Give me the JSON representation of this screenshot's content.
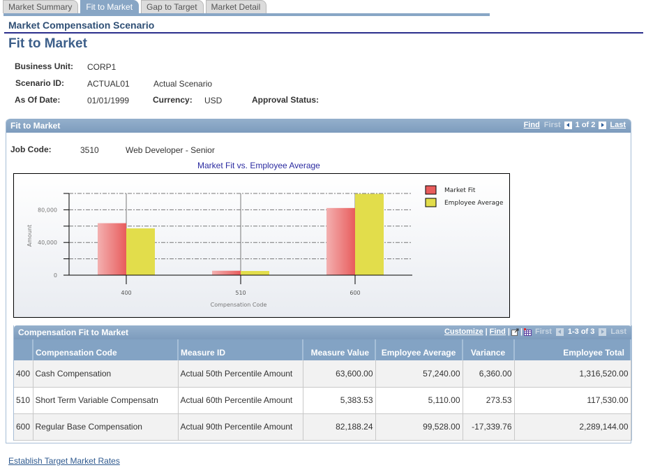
{
  "tabs": [
    {
      "label": "Market Summary",
      "active": false
    },
    {
      "label": "Fit to Market",
      "active": true
    },
    {
      "label": "Gap to Target",
      "active": false
    },
    {
      "label": "Market Detail",
      "active": false
    }
  ],
  "header": {
    "subtitle": "Market Compensation Scenario",
    "title": "Fit to Market"
  },
  "info": {
    "business_unit_label": "Business Unit:",
    "business_unit": "CORP1",
    "scenario_id_label": "Scenario ID:",
    "scenario_id": "ACTUAL01",
    "scenario_desc": "Actual Scenario",
    "as_of_date_label": "As Of Date:",
    "as_of_date": "01/01/1999",
    "currency_label": "Currency:",
    "currency": "USD",
    "approval_status_label": "Approval Status:"
  },
  "group": {
    "title": "Fit to Market",
    "nav": {
      "find": "Find",
      "first": "First",
      "position": "1 of 2",
      "last": "Last"
    },
    "job_code_label": "Job Code:",
    "job_code": "3510",
    "job_desc": "Web Developer - Senior"
  },
  "chart_data": {
    "type": "bar",
    "title": "Market Fit vs. Employee Average",
    "xlabel": "Compensation Code",
    "ylabel": "Amount",
    "categories": [
      "400",
      "510",
      "600"
    ],
    "series": [
      {
        "name": "Market Fit",
        "values": [
          63600.0,
          5383.53,
          82188.24
        ],
        "color": "#e85c5c"
      },
      {
        "name": "Employee Average",
        "values": [
          57240.0,
          5110.0,
          99528.0
        ],
        "color": "#e2dd4b"
      }
    ],
    "ylim": [
      0,
      100000
    ],
    "yticks": [
      0,
      20000,
      40000,
      60000,
      80000,
      100000
    ],
    "ytick_labels": [
      "0",
      "",
      "40,000",
      "",
      "80,000",
      ""
    ],
    "grid": true,
    "legend": "top-right"
  },
  "grid": {
    "title": "Compensation Fit to Market",
    "nav": {
      "customize": "Customize",
      "find": "Find",
      "first": "First",
      "position": "1-3 of 3",
      "last": "Last"
    },
    "columns": [
      "",
      "Compensation Code",
      "Measure ID",
      "Measure Value",
      "Employee Average",
      "Variance",
      "Employee Total"
    ],
    "rows": [
      {
        "code": "400",
        "desc": "Cash Compensation",
        "measure": "Actual 50th Percentile Amount",
        "value": "63,600.00",
        "avg": "57,240.00",
        "variance": "6,360.00",
        "total": "1,316,520.00"
      },
      {
        "code": "510",
        "desc": "Short Term Variable Compensatn",
        "measure": "Actual 60th Percentile Amount",
        "value": "5,383.53",
        "avg": "5,110.00",
        "variance": "273.53",
        "total": "117,530.00"
      },
      {
        "code": "600",
        "desc": "Regular Base Compensation",
        "measure": "Actual 90th Percentile Amount",
        "value": "82,188.24",
        "avg": "99,528.00",
        "variance": "-17,339.76",
        "total": "2,289,144.00"
      }
    ]
  },
  "footer": {
    "link": "Establish Target Market Rates"
  }
}
